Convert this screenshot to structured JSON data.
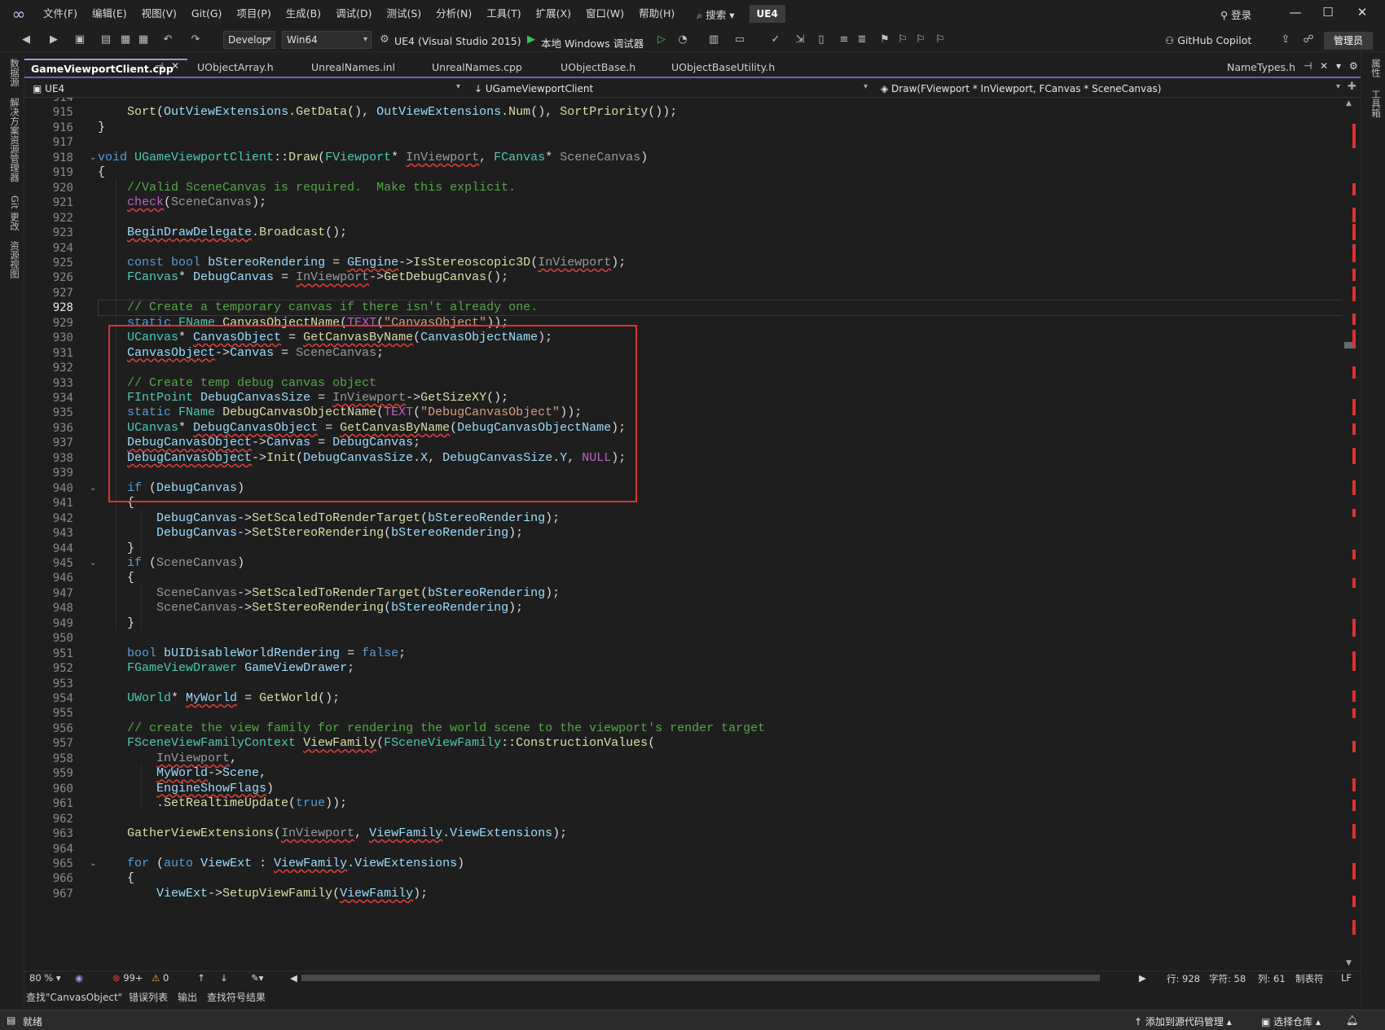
{
  "menubar": {
    "items": [
      "文件(F)",
      "编辑(E)",
      "视图(V)",
      "Git(G)",
      "项目(P)",
      "生成(B)",
      "调试(D)",
      "测试(S)",
      "分析(N)",
      "工具(T)",
      "扩展(X)",
      "窗口(W)",
      "帮助(H)"
    ],
    "search": "搜索",
    "solution_badge": "UE4",
    "login": "登录"
  },
  "toolbar": {
    "config": "Develop",
    "platform": "Win64",
    "startup_project": "UE4 (Visual Studio 2015)",
    "debugger": "本地 Windows 调试器",
    "copilot": "GitHub Copilot",
    "admin": "管理员"
  },
  "left_strip": {
    "labels": [
      "数据源",
      "解决方案资源管理器",
      "Git 更改",
      "资源视图"
    ]
  },
  "right_strip": {
    "labels": [
      "属性",
      "工具箱"
    ]
  },
  "tabs": [
    {
      "label": "GameViewportClient.cpp",
      "active": true
    },
    {
      "label": "UObjectArray.h"
    },
    {
      "label": "UnrealNames.inl"
    },
    {
      "label": "UnrealNames.cpp"
    },
    {
      "label": "UObjectBase.h"
    },
    {
      "label": "UObjectBaseUtility.h"
    }
  ],
  "tab_right": "NameTypes.h",
  "navbar": {
    "project": "UE4",
    "scope": "UGameViewportClient",
    "member": "Draw(FViewport * InViewport, FCanvas * SceneCanvas)"
  },
  "editor": {
    "current_line": 928,
    "lines": [
      {
        "n": 914,
        "code": ""
      },
      {
        "n": 915,
        "code": "    Sort(OutViewExtensions.GetData(), OutViewExtensions.Num(), SortPriority());"
      },
      {
        "n": 916,
        "code": "}"
      },
      {
        "n": 917,
        "code": ""
      },
      {
        "n": 918,
        "code": "void UGameViewportClient::Draw(FViewport* InViewport, FCanvas* SceneCanvas)"
      },
      {
        "n": 919,
        "code": "{"
      },
      {
        "n": 920,
        "code": "    //Valid SceneCanvas is required.  Make this explicit."
      },
      {
        "n": 921,
        "code": "    check(SceneCanvas);"
      },
      {
        "n": 922,
        "code": ""
      },
      {
        "n": 923,
        "code": "    BeginDrawDelegate.Broadcast();"
      },
      {
        "n": 924,
        "code": ""
      },
      {
        "n": 925,
        "code": "    const bool bStereoRendering = GEngine->IsStereoscopic3D(InViewport);"
      },
      {
        "n": 926,
        "code": "    FCanvas* DebugCanvas = InViewport->GetDebugCanvas();"
      },
      {
        "n": 927,
        "code": ""
      },
      {
        "n": 928,
        "code": "    // Create a temporary canvas if there isn't already one."
      },
      {
        "n": 929,
        "code": "    static FName CanvasObjectName(TEXT(\"CanvasObject\"));"
      },
      {
        "n": 930,
        "code": "    UCanvas* CanvasObject = GetCanvasByName(CanvasObjectName);"
      },
      {
        "n": 931,
        "code": "    CanvasObject->Canvas = SceneCanvas;"
      },
      {
        "n": 932,
        "code": ""
      },
      {
        "n": 933,
        "code": "    // Create temp debug canvas object"
      },
      {
        "n": 934,
        "code": "    FIntPoint DebugCanvasSize = InViewport->GetSizeXY();"
      },
      {
        "n": 935,
        "code": "    static FName DebugCanvasObjectName(TEXT(\"DebugCanvasObject\"));"
      },
      {
        "n": 936,
        "code": "    UCanvas* DebugCanvasObject = GetCanvasByName(DebugCanvasObjectName);"
      },
      {
        "n": 937,
        "code": "    DebugCanvasObject->Canvas = DebugCanvas;"
      },
      {
        "n": 938,
        "code": "    DebugCanvasObject->Init(DebugCanvasSize.X, DebugCanvasSize.Y, NULL);"
      },
      {
        "n": 939,
        "code": ""
      },
      {
        "n": 940,
        "code": "    if (DebugCanvas)"
      },
      {
        "n": 941,
        "code": "    {"
      },
      {
        "n": 942,
        "code": "        DebugCanvas->SetScaledToRenderTarget(bStereoRendering);"
      },
      {
        "n": 943,
        "code": "        DebugCanvas->SetStereoRendering(bStereoRendering);"
      },
      {
        "n": 944,
        "code": "    }"
      },
      {
        "n": 945,
        "code": "    if (SceneCanvas)"
      },
      {
        "n": 946,
        "code": "    {"
      },
      {
        "n": 947,
        "code": "        SceneCanvas->SetScaledToRenderTarget(bStereoRendering);"
      },
      {
        "n": 948,
        "code": "        SceneCanvas->SetStereoRendering(bStereoRendering);"
      },
      {
        "n": 949,
        "code": "    }"
      },
      {
        "n": 950,
        "code": ""
      },
      {
        "n": 951,
        "code": "    bool bUIDisableWorldRendering = false;"
      },
      {
        "n": 952,
        "code": "    FGameViewDrawer GameViewDrawer;"
      },
      {
        "n": 953,
        "code": ""
      },
      {
        "n": 954,
        "code": "    UWorld* MyWorld = GetWorld();"
      },
      {
        "n": 955,
        "code": ""
      },
      {
        "n": 956,
        "code": "    // create the view family for rendering the world scene to the viewport's render target"
      },
      {
        "n": 957,
        "code": "    FSceneViewFamilyContext ViewFamily(FSceneViewFamily::ConstructionValues("
      },
      {
        "n": 958,
        "code": "        InViewport,"
      },
      {
        "n": 959,
        "code": "        MyWorld->Scene,"
      },
      {
        "n": 960,
        "code": "        EngineShowFlags)"
      },
      {
        "n": 961,
        "code": "        .SetRealtimeUpdate(true));"
      },
      {
        "n": 962,
        "code": ""
      },
      {
        "n": 963,
        "code": "    GatherViewExtensions(InViewport, ViewFamily.ViewExtensions);"
      },
      {
        "n": 964,
        "code": ""
      },
      {
        "n": 965,
        "code": "    for (auto ViewExt : ViewFamily.ViewExtensions)"
      },
      {
        "n": 966,
        "code": "    {"
      },
      {
        "n": 967,
        "code": "        ViewExt->SetupViewFamily(ViewFamily);"
      }
    ]
  },
  "editor_status": {
    "zoom": "80 %",
    "errors": "99+",
    "warnings": "0",
    "line": "行: 928",
    "char": "字符: 58",
    "col": "列: 61",
    "indent": "制表符",
    "eol": "LF"
  },
  "panel_tabs": [
    "查找\"CanvasObject\"",
    "错误列表",
    "输出",
    "查找符号结果"
  ],
  "status": {
    "ready": "就绪",
    "add_source": "添加到源代码管理",
    "select_repo": "选择仓库"
  },
  "colors": {
    "accent": "#6b5fbf",
    "highlight_box": "#e03030",
    "keyword": "#569cd6",
    "type": "#4ec9b0",
    "comment": "#57a64a"
  }
}
